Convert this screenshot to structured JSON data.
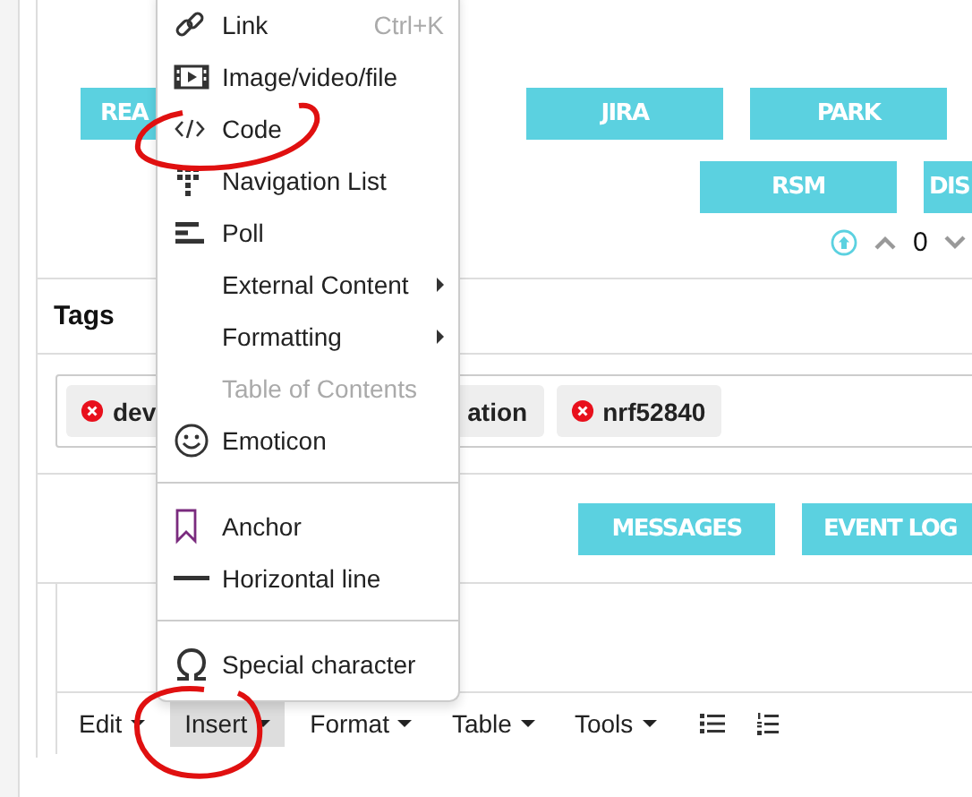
{
  "top_buttons_row1": [
    {
      "label": "REA"
    },
    {
      "label": "JIRA"
    },
    {
      "label": "PARK"
    }
  ],
  "top_buttons_row2": [
    {
      "label": "RSM"
    },
    {
      "label": "DIS"
    }
  ],
  "votes": {
    "count": "0"
  },
  "tags": {
    "title": "Tags",
    "chips": [
      {
        "text_start": "dev",
        "text_end": "ation"
      },
      {
        "text_start": "nrf52840"
      }
    ]
  },
  "action_buttons": [
    {
      "label": "MESSAGES"
    },
    {
      "label": "EVENT LOG"
    }
  ],
  "editor": {
    "menubar": [
      {
        "label": "Edit",
        "selected": false
      },
      {
        "label": "Insert",
        "selected": true
      },
      {
        "label": "Format",
        "selected": false
      },
      {
        "label": "Table",
        "selected": false
      },
      {
        "label": "Tools",
        "selected": false
      }
    ]
  },
  "insert_menu": {
    "items": [
      {
        "kind": "item",
        "label": "Link",
        "shortcut": "Ctrl+K",
        "disabled": false,
        "has_submenu": false
      },
      {
        "kind": "item",
        "label": "Image/video/file",
        "disabled": false,
        "has_submenu": false
      },
      {
        "kind": "item",
        "label": "Code",
        "disabled": false,
        "has_submenu": false
      },
      {
        "kind": "item",
        "label": "Navigation List",
        "disabled": false,
        "has_submenu": false
      },
      {
        "kind": "item",
        "label": "Poll",
        "disabled": false,
        "has_submenu": false
      },
      {
        "kind": "item",
        "label": "External Content",
        "disabled": false,
        "has_submenu": true
      },
      {
        "kind": "item",
        "label": "Formatting",
        "disabled": false,
        "has_submenu": true
      },
      {
        "kind": "item",
        "label": "Table of Contents",
        "disabled": true,
        "has_submenu": false
      },
      {
        "kind": "item",
        "label": "Emoticon",
        "disabled": false,
        "has_submenu": false
      },
      {
        "kind": "separator"
      },
      {
        "kind": "item",
        "label": "Anchor",
        "disabled": false,
        "has_submenu": false
      },
      {
        "kind": "item",
        "label": "Horizontal line",
        "disabled": false,
        "has_submenu": false
      },
      {
        "kind": "separator"
      },
      {
        "kind": "item",
        "label": "Special character",
        "disabled": false,
        "has_submenu": false
      }
    ]
  }
}
